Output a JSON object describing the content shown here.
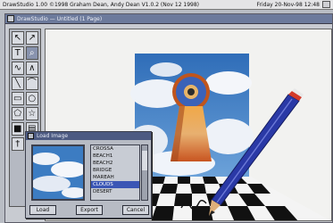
{
  "screen": {
    "title": "DrawStudio 1.00 ©1998 Graham Dean, Andy Dean V1.0.2 (Nov 12 1998)",
    "clock": "Friday 20-Nov-98 12:48"
  },
  "window": {
    "title": "DrawStudio — Untitled (1 Page)"
  },
  "toolbox": {
    "tools": [
      {
        "name": "select-arrow-icon",
        "glyph": "↖"
      },
      {
        "name": "node-edit-icon",
        "glyph": "↗"
      },
      {
        "name": "text-tool-icon",
        "glyph": "T"
      },
      {
        "name": "zoom-icon",
        "glyph": "⌕"
      },
      {
        "name": "freehand-icon",
        "glyph": "∿"
      },
      {
        "name": "pen-tool-icon",
        "glyph": "∧"
      },
      {
        "name": "line-tool-icon",
        "glyph": "╲"
      },
      {
        "name": "curve-tool-icon",
        "glyph": "⌒"
      },
      {
        "name": "rectangle-tool-icon",
        "glyph": "▭"
      },
      {
        "name": "ellipse-tool-icon",
        "glyph": "○"
      },
      {
        "name": "polygon-tool-icon",
        "glyph": "⬠"
      },
      {
        "name": "star-tool-icon",
        "glyph": "☆"
      },
      {
        "name": "fill-tool-icon",
        "glyph": "■"
      },
      {
        "name": "gradient-tool-icon",
        "glyph": "▤"
      },
      {
        "name": "eyedropper-tool-icon",
        "glyph": "†"
      },
      {
        "name": "hand-tool-icon",
        "glyph": "✋"
      }
    ]
  },
  "dialog": {
    "title": "Load Image",
    "files": [
      "CROSSA",
      "BEACH1",
      "BEACH2",
      "BRIDGE",
      "MAREAH",
      "CLOUDS",
      "DESERT"
    ],
    "selected_index": 5,
    "buttons": [
      "Load",
      "Export",
      "Cancel"
    ]
  },
  "colors": {
    "sky": "#3f7fc4",
    "cloud": "#f2f4f8",
    "keyhole_top": "#e8a040",
    "keyhole_bottom": "#d85a20",
    "pencil": "#2b3aa8",
    "accent": "#4c5a82"
  }
}
